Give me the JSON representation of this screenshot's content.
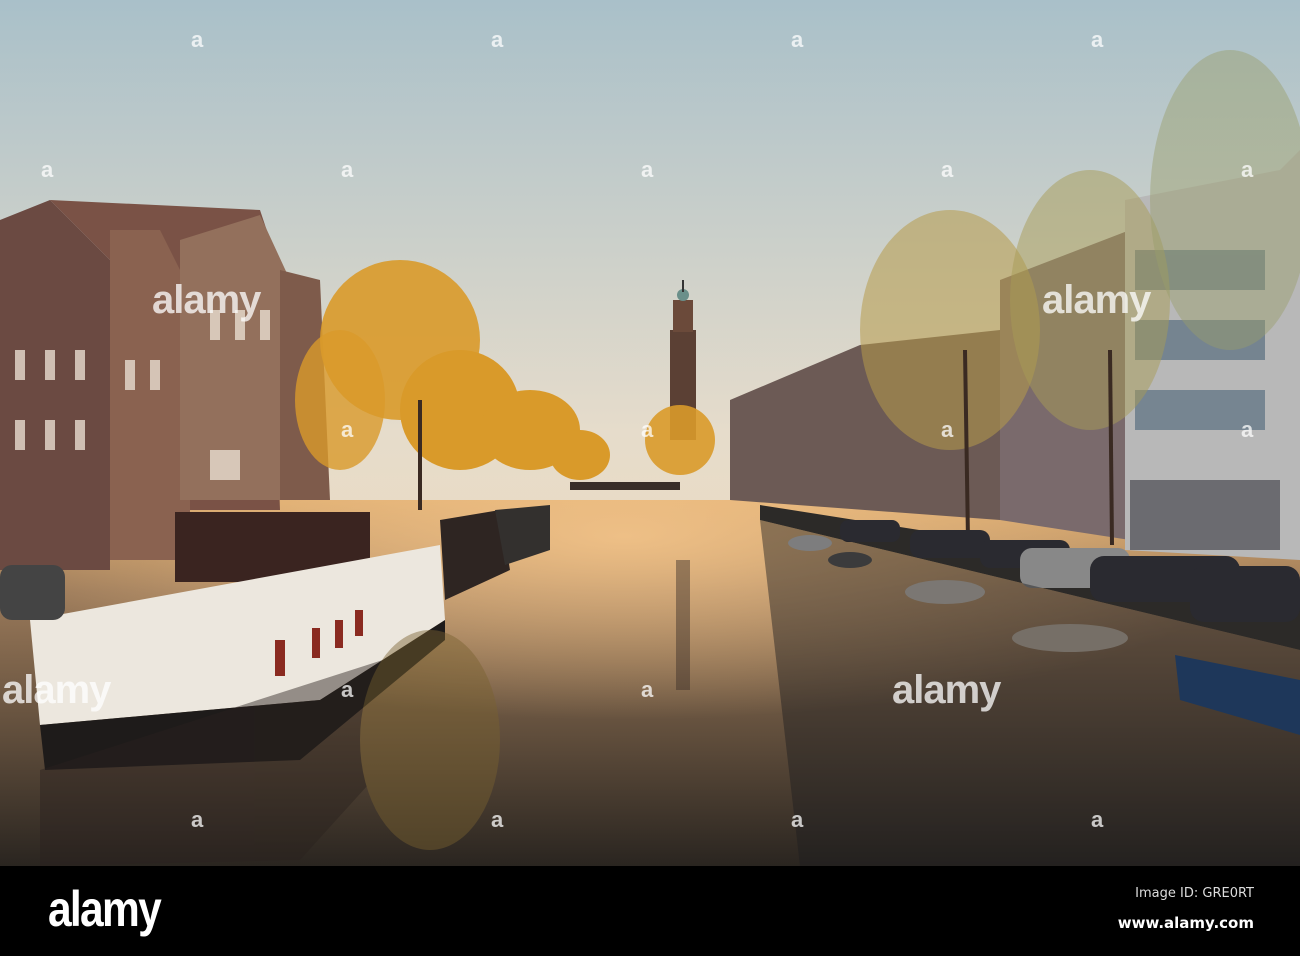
{
  "watermark": {
    "mark": "a",
    "word": "alamy"
  },
  "footer": {
    "logo": "alamy",
    "image_id": "Image ID: GRE0RT",
    "website": "www.alamy.com"
  },
  "colors": {
    "sky_top": "#a9c0c9",
    "sky_bottom": "#f2d9b4",
    "foliage": "#d99a2a",
    "water": "#3a332c"
  }
}
